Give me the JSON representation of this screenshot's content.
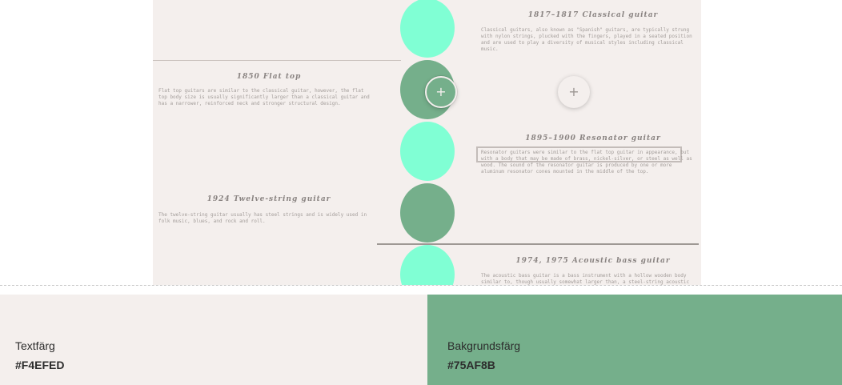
{
  "preview": {
    "entries": [
      {
        "title": "1817–1817 Classical guitar",
        "text": "Classical guitars, also known as \"Spanish\" guitars, are typically strung with nylon strings, plucked with the fingers, played in a seated position and are used to play a diversity of musical styles including classical music."
      },
      {
        "title": "1850 Flat top",
        "text": "Flat top guitars are similar to the classical guitar, however, the flat top body size is usually significantly larger than a classical guitar and has a narrower, reinforced neck and stronger structural design."
      },
      {
        "title": "1895–1900 Resonator guitar",
        "text": "Resonator guitars were similar to the flat top guitar in appearance, but with a body that may be made of brass, nickel-silver, or steel as well as wood. The sound of the resonator guitar is produced by one or more aluminum resonator cones mounted in the middle of the top."
      },
      {
        "title": "1924 Twelve-string guitar",
        "text": "The twelve-string guitar usually has steel strings and is widely used in folk music, blues, and rock and roll."
      },
      {
        "title": "1974, 1975 Acoustic bass guitar",
        "text": "The acoustic bass guitar is a bass instrument with a hollow wooden body similar to, though usually somewhat larger than, a steel-string acoustic guitar."
      }
    ],
    "fab_primary_icon": "+",
    "fab_secondary_icon": "+",
    "icons": {
      "fab_primary": "plus-icon",
      "fab_secondary": "plus-icon"
    },
    "colors": {
      "mint": "#80FFD4",
      "green": "#75AF8B",
      "card_bg": "#F4EFED"
    }
  },
  "swatches": {
    "text": {
      "label": "Textfärg",
      "hex": "#F4EFED"
    },
    "background": {
      "label": "Bakgrundsfärg",
      "hex": "#75AF8B"
    }
  }
}
